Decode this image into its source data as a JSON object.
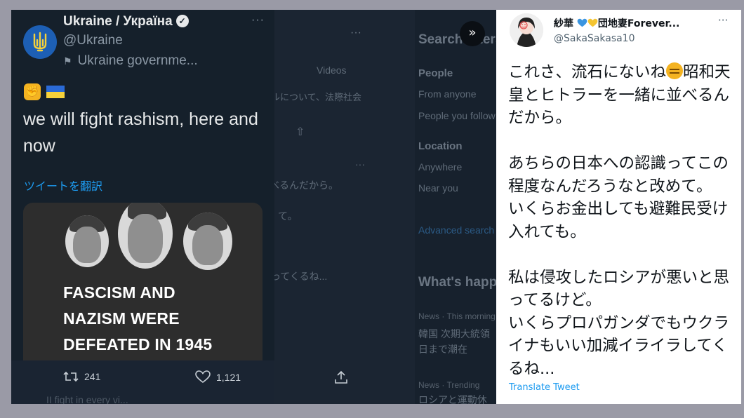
{
  "background_page": {
    "videos_tab": "Videos",
    "jp_snippet_1": "ルについて、法際社会",
    "jp_snippet_2": "べるんだから。",
    "jp_snippet_3": "て。",
    "jp_snippet_4": "ってくるね...",
    "search_filters_title": "Search filters",
    "people_heading": "People",
    "from_anyone": "From anyone",
    "people_you_follow": "People you follow",
    "location_heading": "Location",
    "anywhere": "Anywhere",
    "near_you": "Near you",
    "advanced_search": "Advanced search",
    "whats_happening": "What's happening",
    "news_meta_1": "News · This morning",
    "news_title_1a": "韓国 次期大統領",
    "news_title_1b": "日まで潮在",
    "news_meta_2": "News · Trending",
    "news_title_2": "ロシアと運動休",
    "bottom_snippet": "II fight in every vi..."
  },
  "tweet_left": {
    "display_name": "Ukraine / Україна",
    "handle": "@Ukraine",
    "account_label": "Ukraine governme...",
    "text": "we will fight rashism, here and now",
    "translate_label": "ツイートを翻訳",
    "image_text_lines": [
      "FASCISM AND",
      "NAZISM WERE",
      "DEFEATED IN 1945"
    ],
    "retweet_count": "241",
    "like_count": "1,121",
    "colors": {
      "background": "#15202b",
      "link": "#1d9bf0"
    }
  },
  "tweet_right": {
    "display_name_prefix": "紗華",
    "display_name_suffix": "団地妻Forever...",
    "handle": "@SakaSakasa10",
    "text_before_emoji": "これさ、流石にないね",
    "text_after_emoji": "昭和天皇とヒトラーを一緒に並べるんだから。\n\nあちらの日本への認識ってこの程度なんだろうなと改めて。\nいくらお金出しても避難民受け入れても。\n\n私は侵攻したロシアが悪いと思ってるけど。\nいくらプロパガンダでもウクライナもいい加減イライラしてくるね...",
    "translate_label": "Translate Tweet",
    "colors": {
      "background": "#ffffff",
      "link": "#1d9bf0",
      "heart_blue": "#3b95e0",
      "heart_yellow": "#f4c430"
    }
  },
  "expand_button_glyph": "»"
}
